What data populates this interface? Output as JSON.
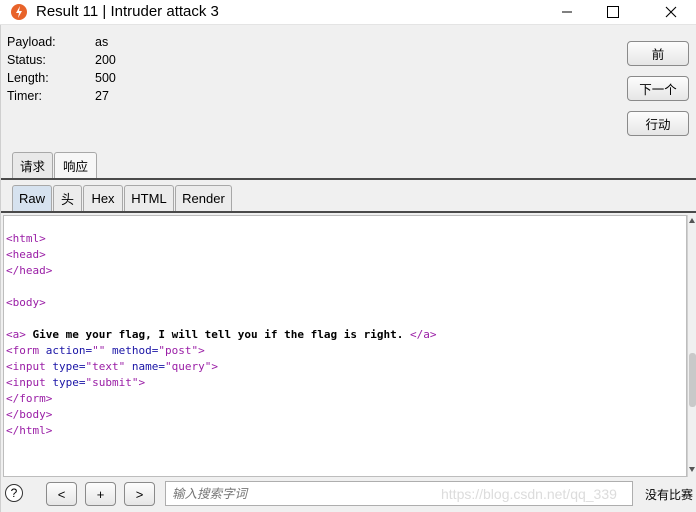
{
  "window": {
    "title": "Result 11 | Intruder attack 3"
  },
  "info": [
    {
      "label": "Payload:",
      "value": "as"
    },
    {
      "label": "Status:",
      "value": "200"
    },
    {
      "label": "Length:",
      "value": "500"
    },
    {
      "label": "Timer:",
      "value": "27"
    }
  ],
  "side_buttons": {
    "prev": "前",
    "next": "下一个",
    "action": "行动"
  },
  "outer_tabs": {
    "request": "请求",
    "response": "响应"
  },
  "inner_tabs": {
    "raw": "Raw",
    "headers": "头",
    "hex": "Hex",
    "html": "HTML",
    "render": "Render"
  },
  "code": {
    "l1": "<html>",
    "l2": "<head>",
    "l3": "</head>",
    "l4": "",
    "l5": "<body>",
    "l6": "",
    "l7_open": "<a>",
    "l7_text": " Give me your flag, I will tell you if the flag is right. ",
    "l7_close": "</a>",
    "l8_tag": "<form",
    "l8_a1": " action=",
    "l8_v1": "\"\"",
    "l8_a2": " method=",
    "l8_v2": "\"post\"",
    "l8_end": ">",
    "l9_tag": "<input",
    "l9_a1": " type=",
    "l9_v1": "\"text\"",
    "l9_a2": " name=",
    "l9_v2": "\"query\"",
    "l9_end": ">",
    "l10_tag": "<input",
    "l10_a1": " type=",
    "l10_v1": "\"submit\"",
    "l10_end": ">",
    "l11": "</form>",
    "l12": "</body>",
    "l13": "</html>"
  },
  "bottom": {
    "help": "?",
    "prev": "<",
    "add": "+",
    "next": ">",
    "search_placeholder": "输入搜索字词",
    "watermark": "https://blog.csdn.net/qq_339",
    "no_match": "没有比赛"
  },
  "colors": {
    "tag": "#9a1ea6",
    "attr": "#1a14a6",
    "tab_active": "#d6e2ef"
  },
  "icons": [
    "burp-icon",
    "minimize-icon",
    "maximize-icon",
    "close-icon"
  ]
}
